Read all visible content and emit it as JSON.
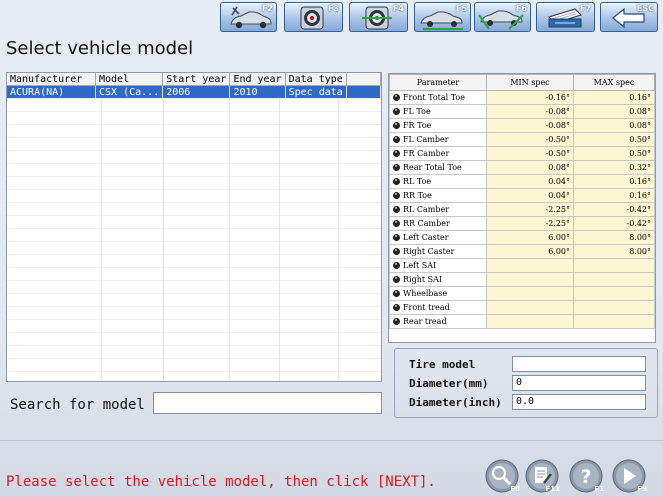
{
  "toolbar": {
    "buttons": [
      {
        "icon": "car-tools-icon",
        "key": "F2"
      },
      {
        "icon": "target-icon",
        "key": "F3"
      },
      {
        "icon": "adjust-target-icon",
        "key": "F4"
      },
      {
        "icon": "car-measure-icon",
        "key": "F5"
      },
      {
        "icon": "car-alignment-icon",
        "key": "F6"
      },
      {
        "icon": "print-icon",
        "key": "F7"
      },
      {
        "icon": "back-arrow-icon",
        "key": "ESC"
      }
    ]
  },
  "page": {
    "title": "Select vehicle model"
  },
  "vehicle_list": {
    "columns": [
      "Manufacturer",
      "Model",
      "Start year",
      "End year",
      "Data type"
    ],
    "rows": [
      {
        "manufacturer": "ACURA(NA)",
        "model": "CSX (Ca...",
        "start_year": "2006",
        "end_year": "2010",
        "data_type": "Spec data"
      }
    ]
  },
  "spec_table": {
    "columns": [
      "Parameter",
      "MIN spec",
      "MAX spec"
    ],
    "rows": [
      {
        "parameter": "Front Total Toe",
        "min": "-0.16°",
        "max": "0.16°"
      },
      {
        "parameter": "FL Toe",
        "min": "-0.08°",
        "max": "0.08°"
      },
      {
        "parameter": "FR Toe",
        "min": "-0.08°",
        "max": "0.08°"
      },
      {
        "parameter": "FL Camber",
        "min": "-0.50°",
        "max": "0.50°"
      },
      {
        "parameter": "FR Camber",
        "min": "-0.50°",
        "max": "0.50°"
      },
      {
        "parameter": "Rear Total Toe",
        "min": "0.08°",
        "max": "0.32°"
      },
      {
        "parameter": "RL Toe",
        "min": "0.04°",
        "max": "0.16°"
      },
      {
        "parameter": "RR Toe",
        "min": "0.04°",
        "max": "0.16°"
      },
      {
        "parameter": "RL Camber",
        "min": "-2.25°",
        "max": "-0.42°"
      },
      {
        "parameter": "RR Camber",
        "min": "-2.25°",
        "max": "-0.42°"
      },
      {
        "parameter": "Left Caster",
        "min": "6.00°",
        "max": "8.00°"
      },
      {
        "parameter": "Right Caster",
        "min": "6.00°",
        "max": "8.00°"
      },
      {
        "parameter": "Left SAI",
        "min": "",
        "max": ""
      },
      {
        "parameter": "Right SAI",
        "min": "",
        "max": ""
      },
      {
        "parameter": "Wheelbase",
        "min": "",
        "max": ""
      },
      {
        "parameter": "Front tread",
        "min": "",
        "max": ""
      },
      {
        "parameter": "Rear tread",
        "min": "",
        "max": ""
      }
    ]
  },
  "tire": {
    "model_label": "Tire model",
    "model_value": "",
    "diameter_mm_label": "Diameter(mm)",
    "diameter_mm_value": "0",
    "diameter_inch_label": "Diameter(inch)",
    "diameter_inch_value": "0.0"
  },
  "search": {
    "label": "Search for model",
    "value": ""
  },
  "status": {
    "message": "Please select the vehicle model, then click [NEXT]."
  },
  "bottom_buttons": [
    {
      "icon": "search-database-icon",
      "key": "F8"
    },
    {
      "icon": "edit-document-icon",
      "key": "F11"
    },
    {
      "icon": "help-icon",
      "key": "F1"
    },
    {
      "icon": "next-arrow-icon",
      "key": "F9"
    }
  ],
  "colors": {
    "selection": "#3169c6",
    "status_text": "#e0161a",
    "spec_value_bg": "#fcf7d2",
    "toolbar_blue": "#88a9d6"
  }
}
